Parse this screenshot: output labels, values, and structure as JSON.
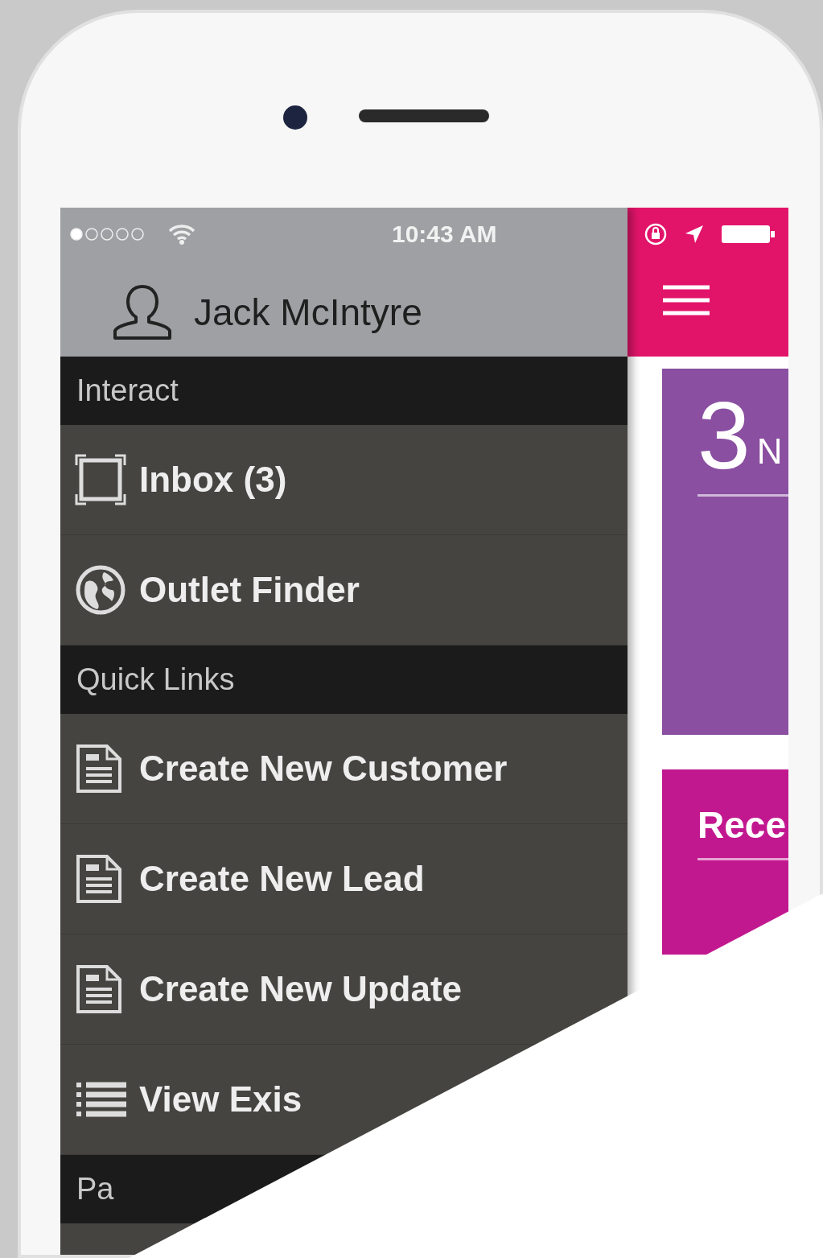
{
  "status_bar": {
    "time": "10:43 AM"
  },
  "drawer": {
    "user_name": "Jack McIntyre",
    "sections": [
      {
        "title": "Interact",
        "items": [
          {
            "kind": "inbox",
            "label": "Inbox (3)"
          },
          {
            "kind": "globe",
            "label": "Outlet Finder"
          }
        ]
      },
      {
        "title": "Quick Links",
        "items": [
          {
            "kind": "document",
            "label": "Create New Customer"
          },
          {
            "kind": "document",
            "label": "Create New Lead"
          },
          {
            "kind": "document",
            "label": "Create New Update"
          },
          {
            "kind": "list",
            "label": "View Exis"
          }
        ]
      },
      {
        "title": "Pa"
      }
    ]
  },
  "main": {
    "cards": [
      {
        "kind": "count",
        "value": "3",
        "label": "N",
        "color": "#8a4fa0"
      },
      {
        "kind": "titled",
        "title": "Rece",
        "color": "#c2188f"
      }
    ]
  }
}
